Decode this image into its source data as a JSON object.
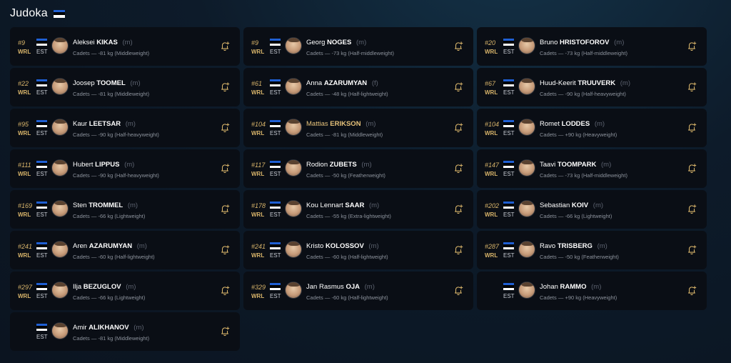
{
  "header": {
    "title": "Judoka"
  },
  "labels": {
    "ranking": "WRL",
    "dash": "—"
  },
  "athletes": [
    {
      "rank": "#9",
      "country": "EST",
      "first": "Aleksei",
      "last": "KIKAS",
      "gender": "(m)",
      "category": "Cadets",
      "weight": "-81 kg (Middleweight)",
      "highlight": false
    },
    {
      "rank": "#9",
      "country": "EST",
      "first": "Georg",
      "last": "NOGES",
      "gender": "(m)",
      "category": "Cadets",
      "weight": "-73 kg (Half-middleweight)",
      "highlight": false
    },
    {
      "rank": "#20",
      "country": "EST",
      "first": "Bruno",
      "last": "HRISTOFOROV",
      "gender": "(m)",
      "category": "Cadets",
      "weight": "-73 kg (Half-middleweight)",
      "highlight": false
    },
    {
      "rank": "#22",
      "country": "EST",
      "first": "Joosep",
      "last": "TOOMEL",
      "gender": "(m)",
      "category": "Cadets",
      "weight": "-81 kg (Middleweight)",
      "highlight": false
    },
    {
      "rank": "#61",
      "country": "EST",
      "first": "Anna",
      "last": "AZARUMYAN",
      "gender": "(f)",
      "category": "Cadets",
      "weight": "-48 kg (Half-lightweight)",
      "highlight": false
    },
    {
      "rank": "#67",
      "country": "EST",
      "first": "Huud-Keerit",
      "last": "TRUUVERK",
      "gender": "(m)",
      "category": "Cadets",
      "weight": "-90 kg (Half-heavyweight)",
      "highlight": false
    },
    {
      "rank": "#95",
      "country": "EST",
      "first": "Kaur",
      "last": "LEETSAR",
      "gender": "(m)",
      "category": "Cadets",
      "weight": "-90 kg (Half-heavyweight)",
      "highlight": false
    },
    {
      "rank": "#104",
      "country": "EST",
      "first": "Mattias",
      "last": "ERIKSON",
      "gender": "(m)",
      "category": "Cadets",
      "weight": "-81 kg (Middleweight)",
      "highlight": true
    },
    {
      "rank": "#104",
      "country": "EST",
      "first": "Romet",
      "last": "LODDES",
      "gender": "(m)",
      "category": "Cadets",
      "weight": "+90 kg (Heavyweight)",
      "highlight": false
    },
    {
      "rank": "#111",
      "country": "EST",
      "first": "Hubert",
      "last": "LIPPUS",
      "gender": "(m)",
      "category": "Cadets",
      "weight": "-90 kg (Half-heavyweight)",
      "highlight": false
    },
    {
      "rank": "#117",
      "country": "EST",
      "first": "Rodion",
      "last": "ZUBETS",
      "gender": "(m)",
      "category": "Cadets",
      "weight": "-50 kg (Featherweight)",
      "highlight": false
    },
    {
      "rank": "#147",
      "country": "EST",
      "first": "Taavi",
      "last": "TOOMPARK",
      "gender": "(m)",
      "category": "Cadets",
      "weight": "-73 kg (Half-middleweight)",
      "highlight": false
    },
    {
      "rank": "#169",
      "country": "EST",
      "first": "Sten",
      "last": "TROMMEL",
      "gender": "(m)",
      "category": "Cadets",
      "weight": "-66 kg (Lightweight)",
      "highlight": false
    },
    {
      "rank": "#178",
      "country": "EST",
      "first": "Kou Lennart",
      "last": "SAAR",
      "gender": "(m)",
      "category": "Cadets",
      "weight": "-55 kg (Extra-lightweight)",
      "highlight": false
    },
    {
      "rank": "#202",
      "country": "EST",
      "first": "Sebastian",
      "last": "KOIV",
      "gender": "(m)",
      "category": "Cadets",
      "weight": "-66 kg (Lightweight)",
      "highlight": false
    },
    {
      "rank": "#241",
      "country": "EST",
      "first": "Aren",
      "last": "AZARUMYAN",
      "gender": "(m)",
      "category": "Cadets",
      "weight": "-60 kg (Half-lightweight)",
      "highlight": false
    },
    {
      "rank": "#241",
      "country": "EST",
      "first": "Kristo",
      "last": "KOLOSSOV",
      "gender": "(m)",
      "category": "Cadets",
      "weight": "-60 kg (Half-lightweight)",
      "highlight": false
    },
    {
      "rank": "#287",
      "country": "EST",
      "first": "Ravo",
      "last": "TRISBERG",
      "gender": "(m)",
      "category": "Cadets",
      "weight": "-50 kg (Featherweight)",
      "highlight": false
    },
    {
      "rank": "#297",
      "country": "EST",
      "first": "Ilja",
      "last": "BEZUGLOV",
      "gender": "(m)",
      "category": "Cadets",
      "weight": "-66 kg (Lightweight)",
      "highlight": false
    },
    {
      "rank": "#329",
      "country": "EST",
      "first": "Jan Rasmus",
      "last": "OJA",
      "gender": "(m)",
      "category": "Cadets",
      "weight": "-60 kg (Half-lightweight)",
      "highlight": false
    },
    {
      "rank": "",
      "country": "EST",
      "first": "Johan",
      "last": "RAMMO",
      "gender": "(m)",
      "category": "Cadets",
      "weight": "+90 kg (Heavyweight)",
      "highlight": false
    },
    {
      "rank": "",
      "country": "EST",
      "first": "Amir",
      "last": "ALIKHANOV",
      "gender": "(m)",
      "category": "Cadets",
      "weight": "-81 kg (Middleweight)",
      "highlight": false
    }
  ],
  "colors": {
    "accent_gold": "#d8b46a",
    "highlight_name": "#e6c27a",
    "card_bg": "#0a0e15",
    "flag_blue": "#1f5fd3"
  },
  "icons": {
    "follow": "bell-plus-icon",
    "flag": "estonia-flag-icon"
  }
}
